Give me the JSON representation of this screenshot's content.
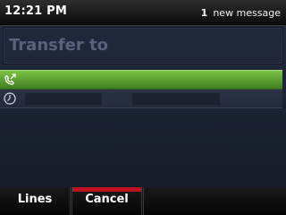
{
  "status_bar": {
    "time": "12:21 PM",
    "notification_count": "1",
    "notification_text": "new message"
  },
  "screen": {
    "title": "Transfer to"
  },
  "rows": [
    {
      "icon": "phone-transfer-icon",
      "state": "selected"
    },
    {
      "icon": "clock-icon",
      "state": "normal"
    }
  ],
  "softkeys": {
    "lines": "Lines",
    "cancel": "Cancel"
  },
  "colors": {
    "selected_row": "#5fa033",
    "active_softkey_indicator": "#c0101a",
    "background": "#1e2535"
  }
}
